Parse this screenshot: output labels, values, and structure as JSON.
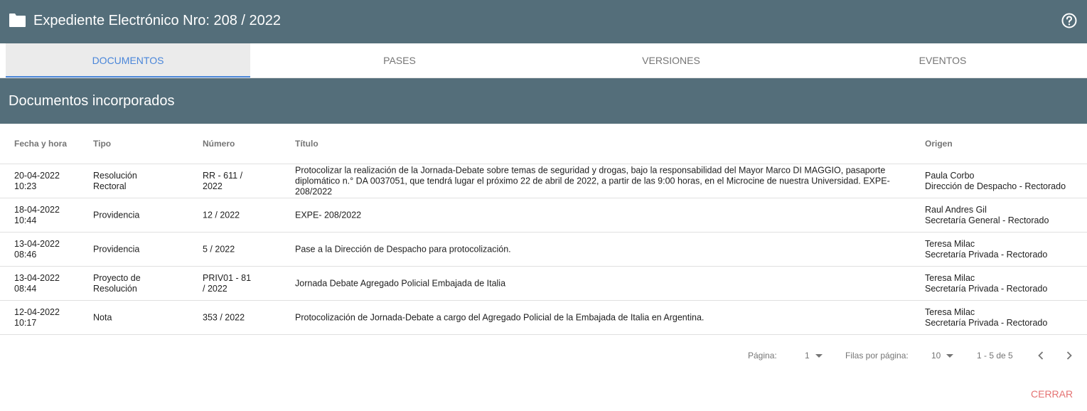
{
  "header": {
    "title": "Expediente Electrónico Nro: 208 / 2022",
    "icon": "folder-icon",
    "help_icon": "help-circle-icon",
    "bg_color": "#546e7a"
  },
  "tabs": [
    {
      "label": "DOCUMENTOS",
      "active": true
    },
    {
      "label": "PASES",
      "active": false
    },
    {
      "label": "VERSIONES",
      "active": false
    },
    {
      "label": "EVENTOS",
      "active": false
    }
  ],
  "section": {
    "title": "Documentos incorporados"
  },
  "table": {
    "columns": [
      "Fecha y hora",
      "Tipo",
      "Número",
      "Título",
      "Origen"
    ],
    "rows": [
      {
        "fecha": "20-04-2022",
        "hora": "10:23",
        "tipo1": "Resolución",
        "tipo2": "Rectoral",
        "num1": "RR - 611 /",
        "num2": "2022",
        "titulo": "Protocolizar la realización de la Jornada-Debate sobre temas de seguridad y drogas, bajo la responsabilidad del Mayor Marco DI MAGGIO, pasaporte diplomático n.° DA 0037051, que tendrá lugar el próximo 22 de abril de 2022, a partir de las 9:00 horas, en el Microcine de nuestra Universidad. EXPE-208/2022",
        "persona": "Paula Corbo",
        "area": "Dirección de Despacho - Rectorado"
      },
      {
        "fecha": "18-04-2022",
        "hora": "10:44",
        "tipo1": "Providencia",
        "tipo2": "",
        "num1": "12 / 2022",
        "num2": "",
        "titulo": "EXPE- 208/2022",
        "persona": "Raul Andres Gil",
        "area": "Secretaría General - Rectorado"
      },
      {
        "fecha": "13-04-2022",
        "hora": "08:46",
        "tipo1": "Providencia",
        "tipo2": "",
        "num1": "5 / 2022",
        "num2": "",
        "titulo": "Pase a la Dirección de Despacho para protocolización.",
        "persona": "Teresa Milac",
        "area": "Secretaría Privada - Rectorado"
      },
      {
        "fecha": "13-04-2022",
        "hora": "08:44",
        "tipo1": "Proyecto de",
        "tipo2": "Resolución",
        "num1": "PRIV01 - 81",
        "num2": "/ 2022",
        "titulo": "Jornada Debate Agregado Policial Embajada de Italia",
        "persona": "Teresa Milac",
        "area": "Secretaría Privada - Rectorado"
      },
      {
        "fecha": "12-04-2022",
        "hora": "10:17",
        "tipo1": "Nota",
        "tipo2": "",
        "num1": "353 / 2022",
        "num2": "",
        "titulo": "Protocolización de Jornada-Debate a cargo del Agregado Policial de la Embajada de Italia en Argentina.",
        "persona": "Teresa Milac",
        "area": "Secretaría Privada - Rectorado"
      }
    ]
  },
  "pagination": {
    "page_label": "Página:",
    "page_value": "1",
    "rows_label": "Filas por página:",
    "rows_value": "10",
    "range": "1 - 5 de 5",
    "prev_icon": "chevron-left-icon",
    "next_icon": "chevron-right-icon"
  },
  "footer": {
    "close_label": "CERRAR"
  }
}
